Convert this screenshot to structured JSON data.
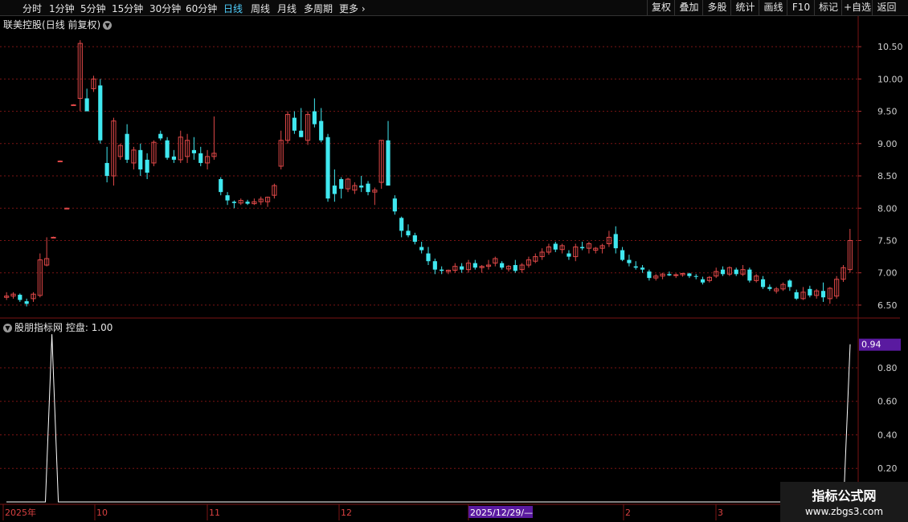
{
  "toolbar": {
    "tabs": [
      "分时",
      "1分钟",
      "5分钟",
      "15分钟",
      "30分钟",
      "60分钟",
      "日线",
      "周线",
      "月线",
      "多周期",
      "更多"
    ],
    "active_tab": "日线",
    "right_buttons": [
      "复权",
      "叠加",
      "多股",
      "统计",
      "画线",
      "F10",
      "标记",
      "+自选",
      "返回"
    ]
  },
  "chart": {
    "stock_name": "联美控股",
    "period_note": "(日线 前复权)"
  },
  "indicator": {
    "name": "股朋指标网",
    "label": "控盘",
    "value": "1.00",
    "current_tag": "0.94"
  },
  "watermark": {
    "line1": "指标公式网",
    "line2": "www.zbgs3.com"
  },
  "colors": {
    "up": "#e04848",
    "down": "#40e8f0",
    "grid": "#7a1414",
    "tag_bg": "#5a1aa0"
  },
  "chart_data": [
    {
      "type": "candlestick",
      "y_ticks": [
        "10.50",
        "10.00",
        "9.50",
        "9.00",
        "8.50",
        "8.00",
        "7.50",
        "7.00",
        "6.50"
      ],
      "ylim": [
        6.35,
        10.75
      ],
      "x_labels": [
        "2025年",
        "10",
        "11",
        "12",
        "2025/12/29/—",
        "2",
        "3"
      ],
      "ohlc": [
        [
          6.62,
          6.7,
          6.58,
          6.64
        ],
        [
          6.64,
          6.7,
          6.6,
          6.67
        ],
        [
          6.66,
          6.68,
          6.55,
          6.58
        ],
        [
          6.56,
          6.6,
          6.48,
          6.52
        ],
        [
          6.6,
          6.7,
          6.55,
          6.67
        ],
        [
          6.65,
          7.3,
          6.62,
          7.2
        ],
        [
          7.12,
          7.55,
          7.1,
          7.22
        ],
        [
          7.55,
          7.56,
          7.55,
          7.55
        ],
        [
          8.73,
          8.74,
          8.73,
          8.73
        ],
        [
          8.0,
          8.01,
          8.0,
          8.0
        ],
        [
          9.6,
          9.61,
          9.6,
          9.6
        ],
        [
          9.7,
          10.6,
          9.5,
          10.55
        ],
        [
          9.7,
          9.85,
          9.5,
          9.5
        ],
        [
          9.85,
          10.05,
          9.8,
          10.0
        ],
        [
          9.9,
          10.0,
          9.0,
          9.05
        ],
        [
          8.7,
          8.95,
          8.4,
          8.5
        ],
        [
          8.5,
          9.4,
          8.35,
          9.35
        ],
        [
          8.8,
          9.0,
          8.75,
          8.97
        ],
        [
          9.15,
          9.3,
          8.7,
          8.75
        ],
        [
          8.7,
          8.95,
          8.6,
          8.9
        ],
        [
          8.9,
          9.0,
          8.5,
          8.6
        ],
        [
          8.75,
          8.85,
          8.45,
          8.55
        ],
        [
          8.7,
          9.05,
          8.65,
          9.02
        ],
        [
          9.15,
          9.2,
          9.05,
          9.08
        ],
        [
          9.05,
          9.1,
          8.75,
          8.78
        ],
        [
          8.8,
          8.9,
          8.7,
          8.75
        ],
        [
          8.75,
          9.2,
          8.7,
          9.1
        ],
        [
          8.8,
          9.15,
          8.7,
          9.05
        ],
        [
          8.9,
          9.1,
          8.75,
          8.85
        ],
        [
          8.85,
          8.95,
          8.65,
          8.7
        ],
        [
          8.7,
          8.9,
          8.6,
          8.8
        ],
        [
          8.8,
          9.42,
          8.75,
          8.85
        ],
        [
          8.45,
          8.48,
          8.2,
          8.25
        ],
        [
          8.2,
          8.25,
          8.05,
          8.12
        ],
        [
          8.1,
          8.12,
          8.0,
          8.08
        ],
        [
          8.08,
          8.15,
          8.05,
          8.12
        ],
        [
          8.1,
          8.13,
          8.05,
          8.07
        ],
        [
          8.07,
          8.15,
          8.05,
          8.1
        ],
        [
          8.1,
          8.18,
          8.05,
          8.14
        ],
        [
          8.1,
          8.18,
          8.02,
          8.17
        ],
        [
          8.2,
          8.38,
          8.15,
          8.35
        ],
        [
          8.65,
          9.2,
          8.6,
          9.05
        ],
        [
          9.05,
          9.5,
          9.0,
          9.45
        ],
        [
          9.4,
          9.5,
          9.15,
          9.2
        ],
        [
          9.2,
          9.55,
          9.1,
          9.1
        ],
        [
          9.05,
          9.5,
          8.98,
          9.45
        ],
        [
          9.5,
          9.7,
          9.25,
          9.3
        ],
        [
          9.35,
          9.55,
          9.02,
          9.05
        ],
        [
          9.1,
          9.15,
          8.1,
          8.15
        ],
        [
          8.35,
          8.6,
          8.1,
          8.22
        ],
        [
          8.45,
          8.48,
          8.15,
          8.3
        ],
        [
          8.3,
          8.47,
          8.25,
          8.45
        ],
        [
          8.28,
          8.4,
          8.22,
          8.35
        ],
        [
          8.35,
          8.5,
          8.25,
          8.32
        ],
        [
          8.38,
          8.42,
          8.2,
          8.25
        ],
        [
          8.25,
          8.32,
          8.05,
          8.28
        ],
        [
          8.4,
          9.05,
          8.3,
          9.05
        ],
        [
          9.05,
          9.35,
          8.5,
          8.35
        ],
        [
          8.15,
          8.2,
          7.9,
          7.95
        ],
        [
          7.85,
          7.87,
          7.55,
          7.65
        ],
        [
          7.65,
          7.75,
          7.55,
          7.58
        ],
        [
          7.58,
          7.62,
          7.44,
          7.48
        ],
        [
          7.4,
          7.48,
          7.3,
          7.35
        ],
        [
          7.3,
          7.4,
          7.12,
          7.18
        ],
        [
          7.18,
          7.22,
          6.98,
          7.05
        ],
        [
          7.05,
          7.1,
          6.98,
          7.03
        ],
        [
          7.02,
          7.05,
          6.98,
          7.04
        ],
        [
          7.04,
          7.15,
          7.0,
          7.1
        ],
        [
          7.1,
          7.15,
          7.0,
          7.05
        ],
        [
          7.05,
          7.2,
          7.0,
          7.15
        ],
        [
          7.15,
          7.2,
          7.05,
          7.08
        ],
        [
          7.08,
          7.12,
          7.0,
          7.1
        ],
        [
          7.1,
          7.2,
          7.05,
          7.12
        ],
        [
          7.15,
          7.25,
          7.1,
          7.22
        ],
        [
          7.15,
          7.18,
          7.05,
          7.08
        ],
        [
          7.06,
          7.12,
          7.02,
          7.1
        ],
        [
          7.12,
          7.2,
          7.0,
          7.03
        ],
        [
          7.05,
          7.15,
          7.0,
          7.12
        ],
        [
          7.12,
          7.25,
          7.08,
          7.2
        ],
        [
          7.18,
          7.3,
          7.15,
          7.25
        ],
        [
          7.25,
          7.38,
          7.2,
          7.32
        ],
        [
          7.32,
          7.45,
          7.28,
          7.4
        ],
        [
          7.45,
          7.48,
          7.32,
          7.36
        ],
        [
          7.36,
          7.45,
          7.3,
          7.42
        ],
        [
          7.3,
          7.35,
          7.2,
          7.25
        ],
        [
          7.25,
          7.45,
          7.18,
          7.4
        ],
        [
          7.4,
          7.48,
          7.35,
          7.38
        ],
        [
          7.38,
          7.48,
          7.3,
          7.45
        ],
        [
          7.35,
          7.4,
          7.3,
          7.38
        ],
        [
          7.38,
          7.45,
          7.3,
          7.42
        ],
        [
          7.45,
          7.65,
          7.4,
          7.55
        ],
        [
          7.6,
          7.72,
          7.3,
          7.38
        ],
        [
          7.35,
          7.4,
          7.18,
          7.2
        ],
        [
          7.2,
          7.28,
          7.1,
          7.15
        ],
        [
          7.1,
          7.18,
          7.05,
          7.08
        ],
        [
          7.08,
          7.12,
          7.0,
          7.05
        ],
        [
          7.02,
          7.05,
          6.88,
          6.92
        ],
        [
          6.92,
          6.98,
          6.88,
          6.95
        ],
        [
          6.95,
          7.0,
          6.9,
          6.98
        ],
        [
          6.98,
          7.02,
          6.95,
          6.96
        ],
        [
          6.96,
          6.99,
          6.92,
          6.97
        ],
        [
          6.97,
          7.0,
          6.94,
          6.99
        ],
        [
          6.99,
          7.0,
          6.92,
          6.95
        ],
        [
          6.95,
          6.98,
          6.9,
          6.94
        ],
        [
          6.9,
          6.94,
          6.82,
          6.85
        ],
        [
          6.88,
          6.95,
          6.85,
          6.93
        ],
        [
          6.95,
          7.08,
          6.92,
          7.02
        ],
        [
          7.05,
          7.1,
          6.95,
          6.98
        ],
        [
          6.98,
          7.1,
          6.95,
          7.08
        ],
        [
          7.05,
          7.08,
          6.95,
          6.98
        ],
        [
          6.98,
          7.12,
          6.95,
          7.05
        ],
        [
          7.05,
          7.08,
          6.85,
          6.88
        ],
        [
          6.88,
          6.98,
          6.85,
          6.95
        ],
        [
          6.9,
          6.95,
          6.75,
          6.78
        ],
        [
          6.78,
          6.82,
          6.72,
          6.75
        ],
        [
          6.72,
          6.78,
          6.68,
          6.75
        ],
        [
          6.75,
          6.85,
          6.72,
          6.82
        ],
        [
          6.88,
          6.9,
          6.72,
          6.78
        ],
        [
          6.7,
          6.74,
          6.58,
          6.6
        ],
        [
          6.6,
          6.78,
          6.58,
          6.7
        ],
        [
          6.75,
          6.8,
          6.62,
          6.65
        ],
        [
          6.65,
          6.75,
          6.6,
          6.72
        ],
        [
          6.72,
          6.85,
          6.55,
          6.62
        ],
        [
          6.6,
          6.78,
          6.52,
          6.76
        ],
        [
          6.64,
          6.95,
          6.6,
          6.9
        ],
        [
          6.9,
          7.12,
          6.86,
          7.08
        ],
        [
          7.05,
          7.68,
          7.0,
          7.5
        ]
      ]
    },
    {
      "type": "line",
      "name": "控盘",
      "y_ticks": [
        "0.94",
        "0.80",
        "0.60",
        "0.40",
        "0.20"
      ],
      "ylim": [
        0,
        1.02
      ],
      "values_note_free": true,
      "series": [
        {
          "name": "控盘",
          "values": [
            0,
            0,
            0,
            0,
            0,
            0,
            0,
            1.0,
            0,
            0,
            0,
            0,
            0,
            0,
            0,
            0,
            0,
            0,
            0,
            0,
            0,
            0,
            0,
            0,
            0,
            0,
            0,
            0,
            0,
            0,
            0,
            0,
            0,
            0,
            0,
            0,
            0,
            0,
            0,
            0,
            0,
            0,
            0,
            0,
            0,
            0,
            0,
            0,
            0,
            0,
            0,
            0,
            0,
            0,
            0,
            0,
            0,
            0,
            0,
            0,
            0,
            0,
            0,
            0,
            0,
            0,
            0,
            0,
            0,
            0,
            0,
            0,
            0,
            0,
            0,
            0,
            0,
            0,
            0,
            0,
            0,
            0,
            0,
            0,
            0,
            0,
            0,
            0,
            0,
            0,
            0,
            0,
            0,
            0,
            0,
            0,
            0,
            0,
            0,
            0,
            0,
            0,
            0,
            0,
            0,
            0,
            0,
            0,
            0,
            0,
            0,
            0,
            0,
            0,
            0,
            0,
            0,
            0,
            0,
            0,
            0,
            0,
            0,
            0,
            0,
            0,
            0,
            0,
            0,
            0.0,
            0.94
          ]
        }
      ]
    }
  ]
}
